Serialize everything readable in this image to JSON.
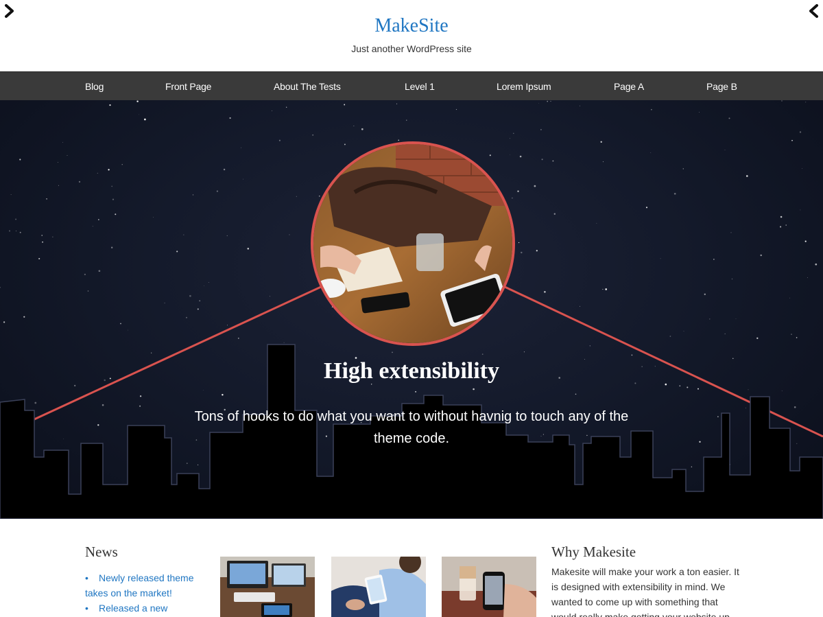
{
  "site": {
    "title": "MakeSite",
    "tagline": "Just another WordPress site"
  },
  "nav": {
    "items": [
      {
        "label": "Blog"
      },
      {
        "label": "Front Page"
      },
      {
        "label": "About The Tests"
      },
      {
        "label": "Level 1"
      },
      {
        "label": "Lorem Ipsum"
      },
      {
        "label": "Page A"
      },
      {
        "label": "Page B"
      }
    ]
  },
  "hero": {
    "title": "High extensibility",
    "text": "Tons of hooks to do what you want to without havnig to touch any of the theme code.",
    "accent_color": "#d9534f"
  },
  "news": {
    "title": "News",
    "items": [
      {
        "line1": "Newly released theme",
        "line2": "takes on the market!"
      },
      {
        "line1": "Released a new",
        "line2": ""
      }
    ]
  },
  "why": {
    "title": "Why Makesite",
    "text": "Makesite will make your work a ton easier. It is designed with extensibility in mind. We wanted to come up with something that would really make getting your website up"
  },
  "colors": {
    "link": "#1f76c2",
    "nav_bg": "#3a3a3a",
    "sky": "#141a2b"
  },
  "icons": {
    "next": "chevron-right-icon",
    "prev": "chevron-left-icon"
  }
}
